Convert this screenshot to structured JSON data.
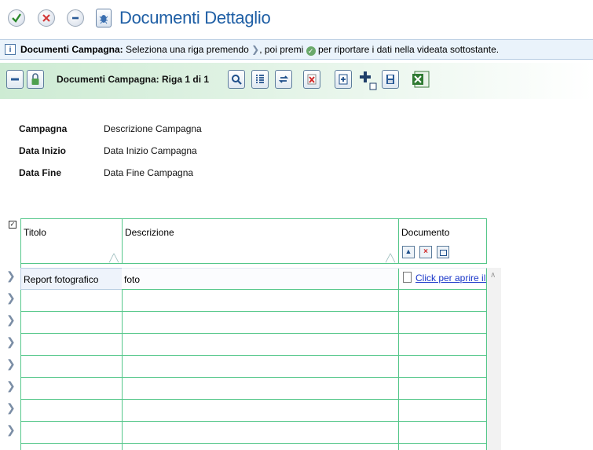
{
  "title": "Documenti Dettaglio",
  "info_bar": {
    "prefix": "Documenti Campagna:",
    "text_a": "Seleziona una riga premendo",
    "text_b": ", poi premi",
    "text_c": "per riportare i dati nella videata sottostante."
  },
  "toolbar": {
    "label": "Documenti Campagna: Riga 1 di 1"
  },
  "form": {
    "fields": [
      {
        "label": "Campagna",
        "value": "Descrizione Campagna"
      },
      {
        "label": "Data Inizio",
        "value": "Data Inizio Campagna"
      },
      {
        "label": "Data Fine",
        "value": "Data Fine Campagna"
      }
    ]
  },
  "grid": {
    "headers": [
      "Titolo",
      "Descrizione",
      "Documento"
    ],
    "rows": [
      {
        "titolo": "Report fotografico",
        "descrizione": "foto",
        "documento": "Click per aprire il d"
      }
    ]
  },
  "icons": {
    "confirm": "check-circle-icon",
    "cancel": "x-circle-icon",
    "minimize": "minus-circle-icon",
    "app": "bug-icon"
  },
  "colors": {
    "accent": "#1f5fa5",
    "grid_line": "#55c78a",
    "info_bg": "#eaf3fb",
    "toolbar_bg": "#cdebd3"
  }
}
